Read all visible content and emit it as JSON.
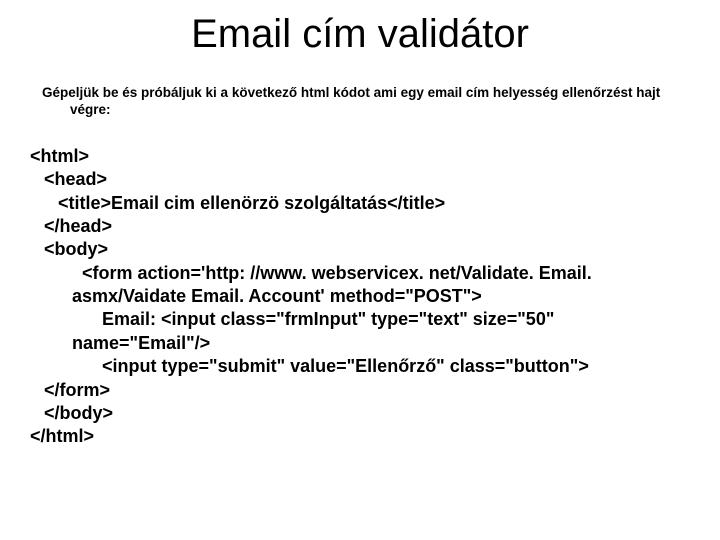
{
  "title": "Email cím validátor",
  "subtitle": "Gépeljük be és próbáljuk ki a következő html kódot ami egy email cím helyesség ellenőrzést hajt végre:",
  "code": {
    "l01": "<html>",
    "l02": "<head>",
    "l03": "<title>Email cim ellenörzö szolgáltatás</title>",
    "l04": "</head>",
    "l05": "<body>",
    "l06": "<form action='http: //www. webservicex. net/Validate. Email. asmx/Vaidate Email. Account' method=\"POST\">",
    "l07": "Email:  <input class=\"frmInput\" type=\"text\" size=\"50\" name=\"Email\"/>",
    "l08": "<input type=\"submit\" value=\"Ellenőrző\" class=\"button\">",
    "l09": "</form>",
    "l10": "</body>",
    "l11": "</html>"
  }
}
